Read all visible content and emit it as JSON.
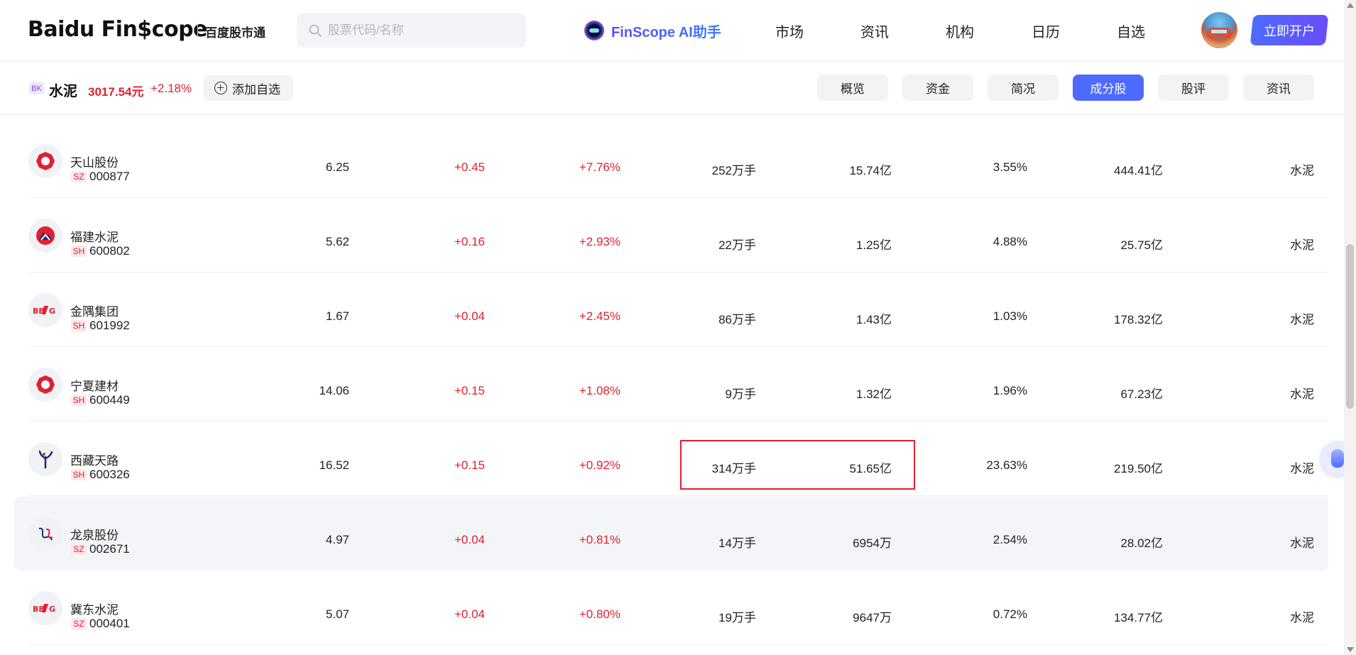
{
  "header": {
    "logo": "Baidu Fin$cope",
    "logo_sub": "百度股市通",
    "search_placeholder": "股票代码/名称",
    "ai_label": "FinScope AI助手",
    "nav": [
      "市场",
      "资讯",
      "机构",
      "日历",
      "自选"
    ],
    "open_account": "立即开户"
  },
  "sector": {
    "badge": "BK",
    "name": "水泥",
    "price": "3017.54元",
    "change": "+2.18%",
    "add_watch": "添加自选"
  },
  "tabs": [
    {
      "label": "概览",
      "active": false
    },
    {
      "label": "资金",
      "active": false
    },
    {
      "label": "简况",
      "active": false
    },
    {
      "label": "成分股",
      "active": true
    },
    {
      "label": "股评",
      "active": false
    },
    {
      "label": "资讯",
      "active": false
    }
  ],
  "stocks": [
    {
      "name": "天山股份",
      "market": "SZ",
      "code": "000877",
      "price": "6.25",
      "change": "+0.45",
      "pct": "+7.76%",
      "volume": "252万手",
      "turnover": "15.74亿",
      "rate": "3.55%",
      "cap": "444.41亿",
      "sector": "水泥",
      "logo": "ring"
    },
    {
      "name": "福建水泥",
      "market": "SH",
      "code": "600802",
      "price": "5.62",
      "change": "+0.16",
      "pct": "+2.93%",
      "volume": "22万手",
      "turnover": "1.25亿",
      "rate": "4.88%",
      "cap": "25.75亿",
      "sector": "水泥",
      "logo": "mountain"
    },
    {
      "name": "金隅集团",
      "market": "SH",
      "code": "601992",
      "price": "1.67",
      "change": "+0.04",
      "pct": "+2.45%",
      "volume": "86万手",
      "turnover": "1.43亿",
      "rate": "1.03%",
      "cap": "178.32亿",
      "sector": "水泥",
      "logo": "bbmg"
    },
    {
      "name": "宁夏建材",
      "market": "SH",
      "code": "600449",
      "price": "14.06",
      "change": "+0.15",
      "pct": "+1.08%",
      "volume": "9万手",
      "turnover": "1.32亿",
      "rate": "1.96%",
      "cap": "67.23亿",
      "sector": "水泥",
      "logo": "ring"
    },
    {
      "name": "西藏天路",
      "market": "SH",
      "code": "600326",
      "price": "16.52",
      "change": "+0.15",
      "pct": "+0.92%",
      "volume": "314万手",
      "turnover": "51.65亿",
      "rate": "23.63%",
      "cap": "219.50亿",
      "sector": "水泥",
      "logo": "tree"
    },
    {
      "name": "龙泉股份",
      "market": "SZ",
      "code": "002671",
      "price": "4.97",
      "change": "+0.04",
      "pct": "+0.81%",
      "volume": "14万手",
      "turnover": "6954万",
      "rate": "2.54%",
      "cap": "28.02亿",
      "sector": "水泥",
      "logo": "swirl"
    },
    {
      "name": "冀东水泥",
      "market": "SZ",
      "code": "000401",
      "price": "5.07",
      "change": "+0.04",
      "pct": "+0.80%",
      "volume": "19万手",
      "turnover": "9647万",
      "rate": "0.72%",
      "cap": "134.77亿",
      "sector": "水泥",
      "logo": "bbmg"
    }
  ],
  "colors": {
    "up": "#e0202f",
    "accent": "#4e6bff"
  }
}
